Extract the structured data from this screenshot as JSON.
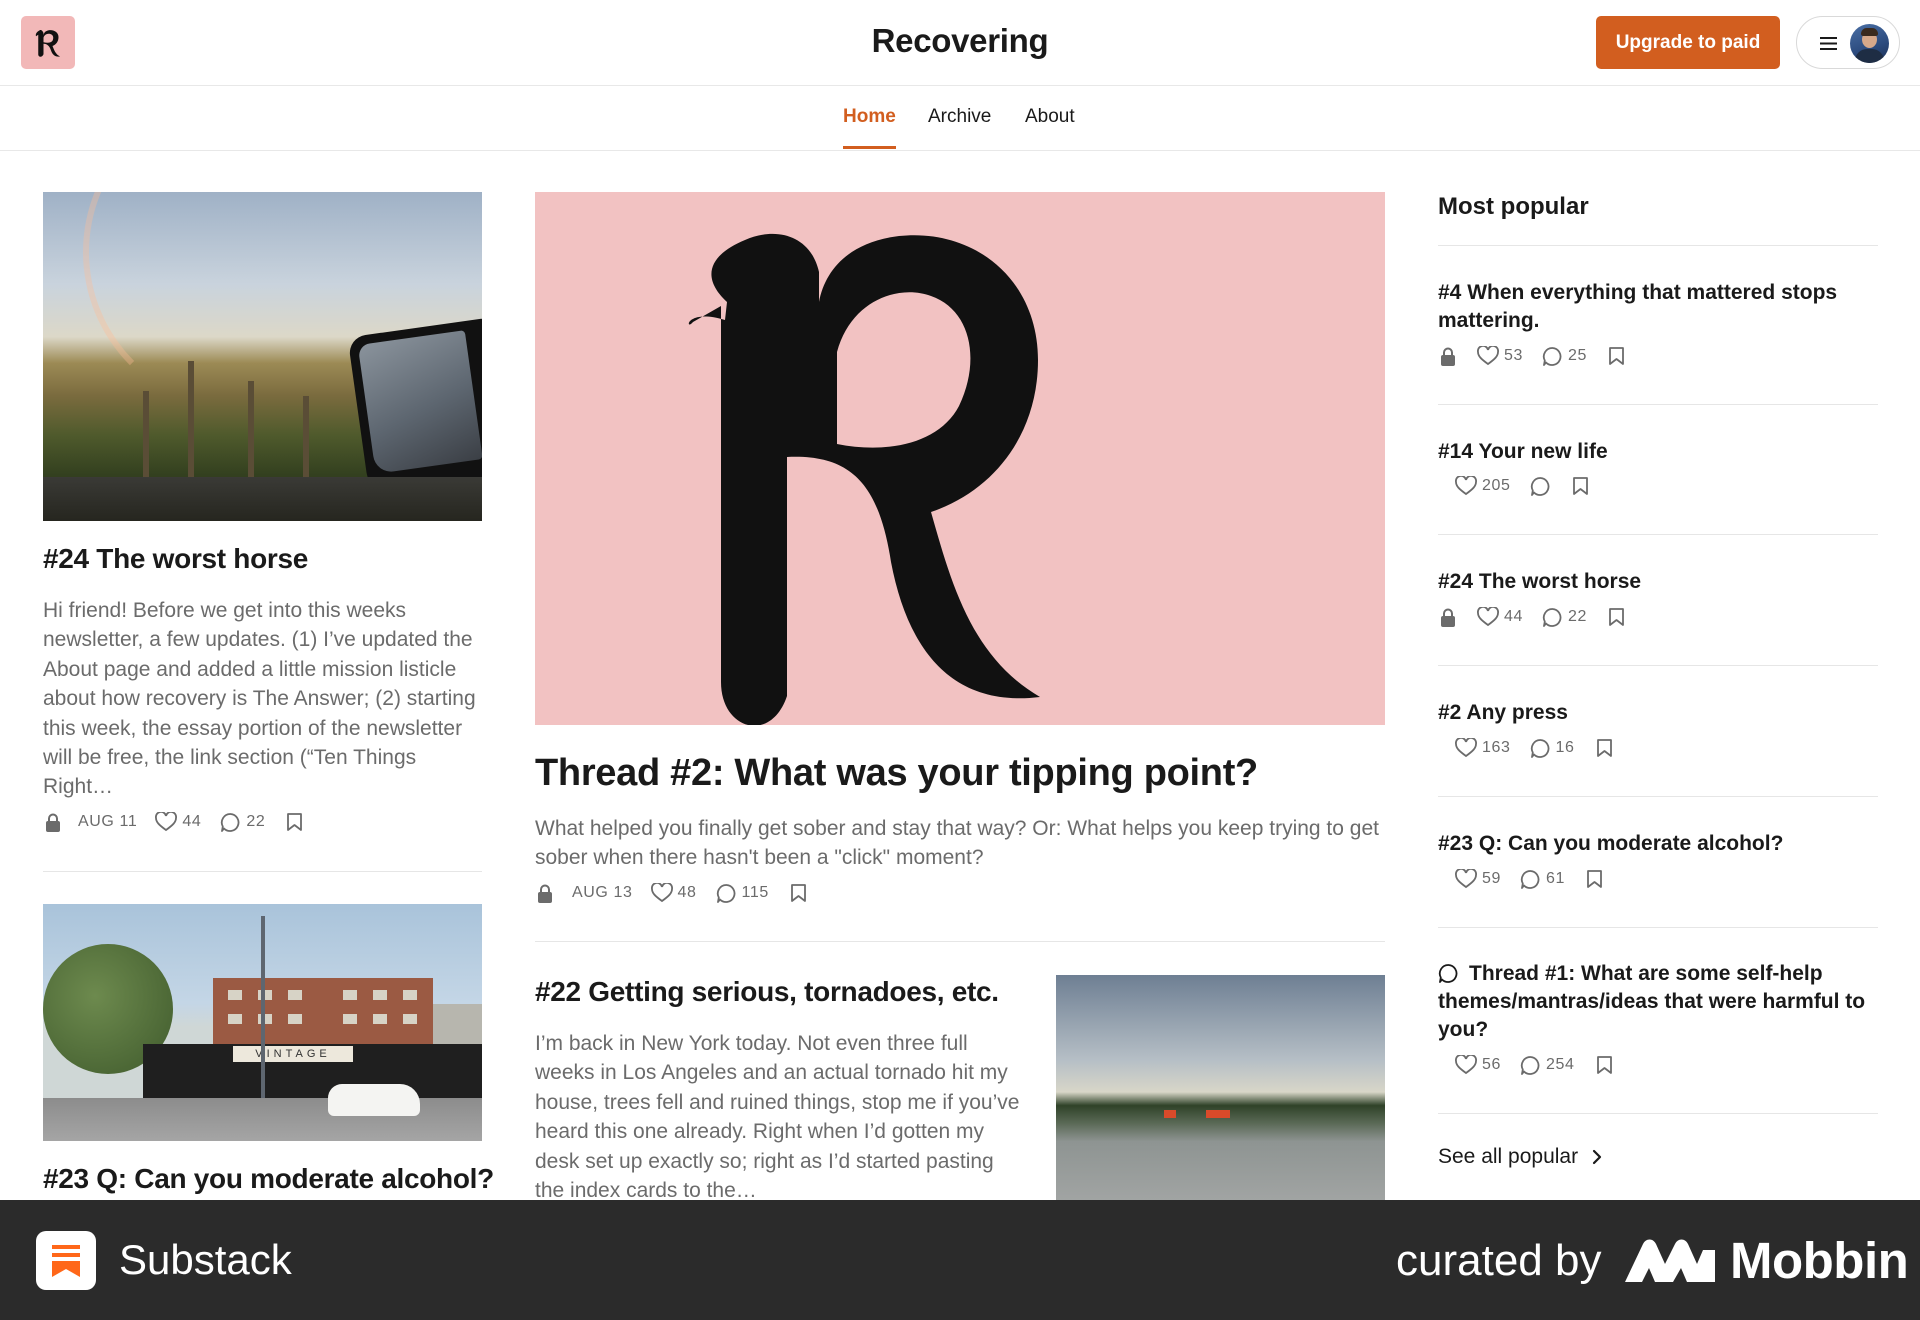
{
  "header": {
    "site_title": "Recovering",
    "upgrade_label": "Upgrade to paid",
    "logo_icon": "blackletter-r-logo",
    "menu_icon": "hamburger-icon"
  },
  "nav": {
    "items": [
      {
        "label": "Home",
        "active": true
      },
      {
        "label": "Archive",
        "active": false
      },
      {
        "label": "About",
        "active": false
      }
    ]
  },
  "feed": {
    "left": [
      {
        "title": "#24 The worst horse",
        "excerpt": "Hi friend! Before we get into this weeks newsletter, a few updates. (1) I’ve updated the About page and added a little mission listicle about how recovery is The Answer; (2) starting this week, the essay portion of the newsletter will be free, the link section (“Ten Things Right…",
        "locked": true,
        "date": "AUG 11",
        "likes": "44",
        "comments": "22"
      },
      {
        "title": "#23 Q: Can you moderate alcohol?"
      }
    ],
    "featured": {
      "title": "Thread #2: What was your tipping point?",
      "excerpt": "What helped you finally get sober and stay that way? Or: What helps you keep trying to get sober when there hasn't been a \"click\" moment?",
      "locked": true,
      "date": "AUG 13",
      "likes": "48",
      "comments": "115"
    },
    "secondary": {
      "title": "#22 Getting serious, tornadoes, etc.",
      "excerpt": "I’m back in New York today. Not even three full weeks in Los Angeles and an actual tornado hit my house, trees fell and ruined things, stop me if you’ve heard this one already. Right when I’d gotten my desk set up exactly so; right as I’d started pasting the index cards to the…"
    }
  },
  "popular": {
    "heading": "Most popular",
    "items": [
      {
        "title": "#4 When everything that mattered stops mattering.",
        "locked": true,
        "likes": "53",
        "comments": "25"
      },
      {
        "title": "#14 Your new life",
        "locked": false,
        "likes": "205",
        "comments": ""
      },
      {
        "title": "#24 The worst horse",
        "locked": true,
        "likes": "44",
        "comments": "22"
      },
      {
        "title": "#2 Any press",
        "locked": false,
        "likes": "163",
        "comments": "16"
      },
      {
        "title": "#23 Q: Can you moderate alcohol?",
        "locked": false,
        "likes": "59",
        "comments": "61"
      },
      {
        "title": "Thread #1: What are some self-help themes/mantras/ideas that were harmful to you?",
        "thread": true,
        "locked": false,
        "likes": "56",
        "comments": "254"
      }
    ],
    "see_all": "See all popular"
  },
  "footer": {
    "app_name": "Substack",
    "curated_by": "curated by",
    "brand": "Mobbin"
  },
  "colors": {
    "accent": "#d25e1f",
    "logo_bg": "#f2b8b8",
    "hero_bg": "#f2c2c2",
    "footer_bg": "#2b2b2b"
  }
}
